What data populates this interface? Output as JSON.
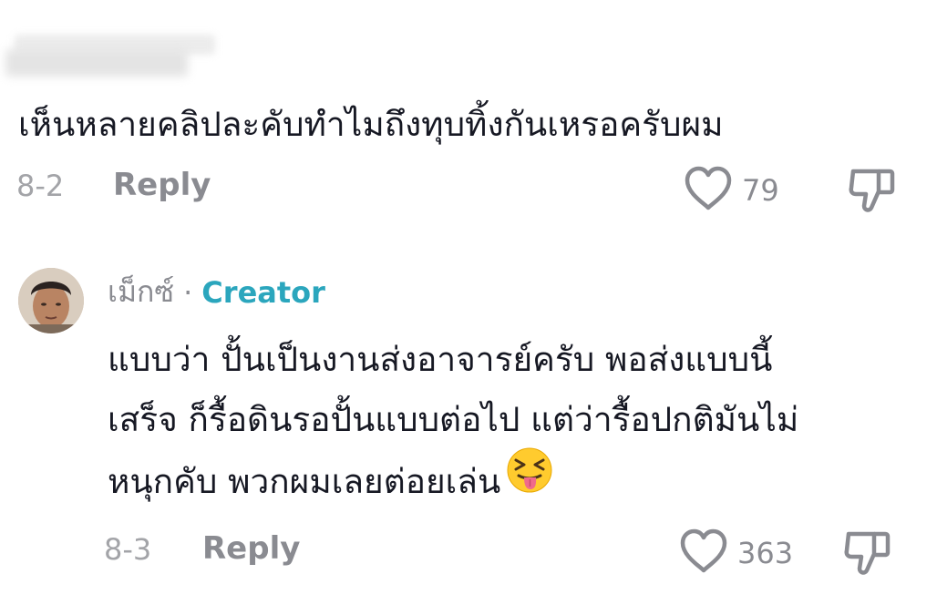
{
  "comment1": {
    "text": "เห็นหลายคลิปละคับทำไมถึงทุบทิ้งกันเหรอครับผม",
    "date": "8-2",
    "reply_label": "Reply",
    "like_count": "79"
  },
  "comment2": {
    "author": "เม็กซ์",
    "separator": "·",
    "badge": "Creator",
    "lines": [
      "แบบว่า ปั้นเป็นงานส่งอาจารย์ครับ พอส่งแบบนี้",
      "เสร็จ ก็รื้อดินรอปั้นแบบต่อไป แต่ว่ารื้อปกติมันไม่",
      "หนุกคับ พวกผมเลยต่อยเล่น"
    ],
    "emoji": "tongue-squint-emoji",
    "date": "8-3",
    "reply_label": "Reply",
    "like_count": "363"
  },
  "colors": {
    "meta_gray": "#8a8b91",
    "date_gray": "#a3a4a8",
    "creator_teal": "#2ba6bd",
    "text": "#161823"
  },
  "icons": {
    "like": "heart-outline-icon",
    "dislike": "thumbs-down-outline-icon"
  }
}
